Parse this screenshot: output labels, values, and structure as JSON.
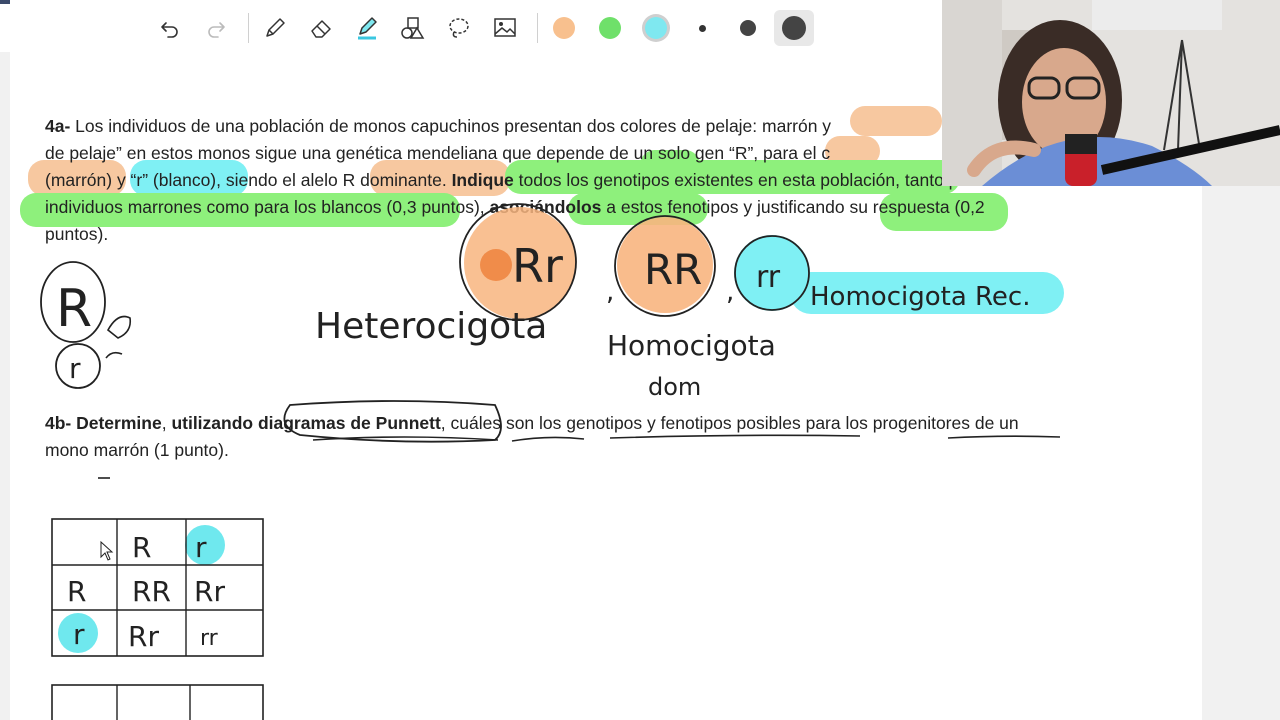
{
  "toolbar": {
    "tools": [
      "undo-icon",
      "redo-icon",
      "pen-icon",
      "eraser-icon",
      "highlighter-icon",
      "shapes-icon",
      "lasso-icon",
      "image-icon"
    ],
    "colors": [
      "#f8c08e",
      "#6fe06a",
      "#7fe8f0"
    ],
    "sizes": [
      "small",
      "medium",
      "large"
    ]
  },
  "q4a": {
    "label": "4a-",
    "line1": " Los individuos de una población de monos capuchinos presentan dos colores de pelaje: marrón y",
    "line2": "de pelaje” en estos monos sigue una genética mendeliana que depende de un solo gen “R”, para el c",
    "line3_a": "(marrón) y “r” (blanco), siendo el alelo R dominante. ",
    "line3_bold": "Indique",
    "line3_b": " todos los genotipos existentes en esta población, tanto para los",
    "line4_a": "individuos marrones como para los blancos (0,3 puntos), ",
    "line4_bold": "asociándolos",
    "line4_b": " a estos fenotipos y justificando su respuesta (0,2",
    "line5": "puntos)."
  },
  "q4b": {
    "label": "4b- Determine",
    "sep": ", ",
    "bold": "utilizando diagramas de Punnett",
    "rest": ", cuáles son los genotipos y fenotipos posibles para los progenitores de un",
    "line2": "mono marrón (1 punto)."
  },
  "handwriting": {
    "g1": "Rr",
    "g2": "RR",
    "g3": "rr",
    "heterocigota": "Heterocigota",
    "homocigota": "Homocigota",
    "dom": "dom",
    "homocigota_rec": "Homocigota Rec.",
    "allele_big": "R",
    "allele_small": "r"
  },
  "punnett": {
    "top": [
      "",
      "R",
      "r"
    ],
    "rows": [
      [
        "R",
        "RR",
        "Rr"
      ],
      [
        "r",
        "Rr",
        "rr"
      ]
    ]
  }
}
